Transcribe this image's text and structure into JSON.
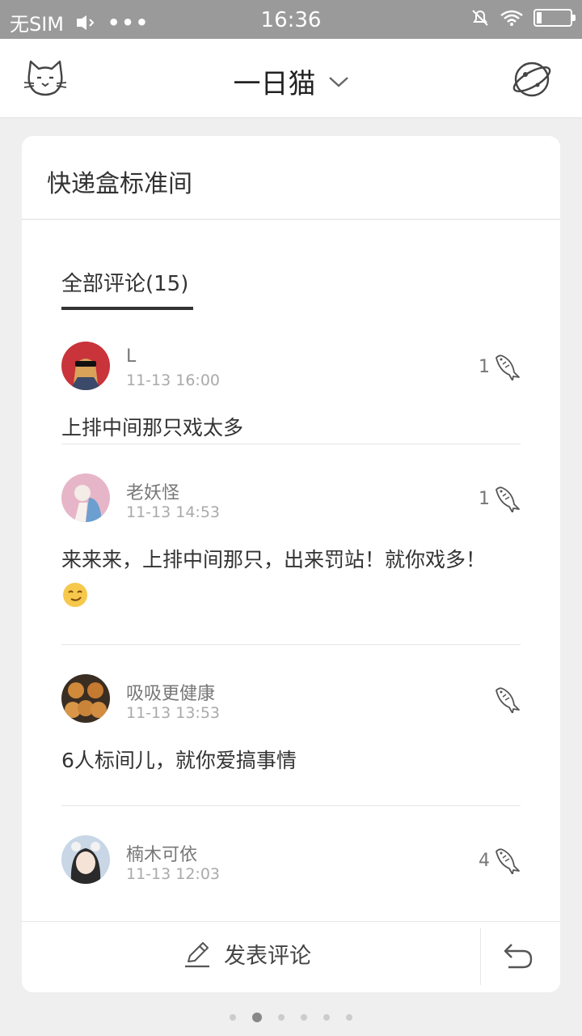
{
  "status_bar": {
    "carrier": "无SIM",
    "time": "16:36"
  },
  "header": {
    "title": "一日猫"
  },
  "card": {
    "title": "快递盒标准间",
    "tab_label": "全部评论(15)",
    "post_label": "发表评论"
  },
  "comments": [
    {
      "name": "L",
      "time": "11-13 16:00",
      "likes": "1",
      "text": "上排中间那只戏太多"
    },
    {
      "name": "老妖怪",
      "time": "11-13 14:53",
      "likes": "1",
      "text": "来来来，上排中间那只，出来罚站！就你戏多！"
    },
    {
      "name": "吸吸更健康",
      "time": "11-13 13:53",
      "likes": "",
      "text": "6人标间儿，就你爱搞事情"
    },
    {
      "name": "楠木可依",
      "time": "11-13 12:03",
      "likes": "4",
      "text": ""
    }
  ],
  "pager": {
    "count": 6,
    "active": 2
  },
  "icons": {
    "header_left": "cat-icon",
    "header_right": "planet-icon",
    "like": "fish-icon",
    "post": "pencil-icon",
    "back": "reply-icon"
  }
}
